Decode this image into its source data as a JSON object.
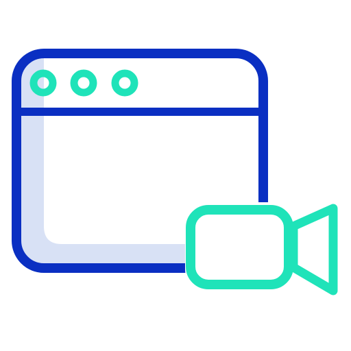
{
  "icon": {
    "name": "browser-video-camera-icon",
    "colors": {
      "outline": "#0A2FC2",
      "fill": "#D8E1F5",
      "accent": "#1FE3B9",
      "background": "#FFFFFF"
    },
    "parts": {
      "window": "browser-window-icon",
      "dots": [
        "window-dot-icon",
        "window-dot-icon",
        "window-dot-icon"
      ],
      "camera": "video-camera-icon"
    }
  }
}
